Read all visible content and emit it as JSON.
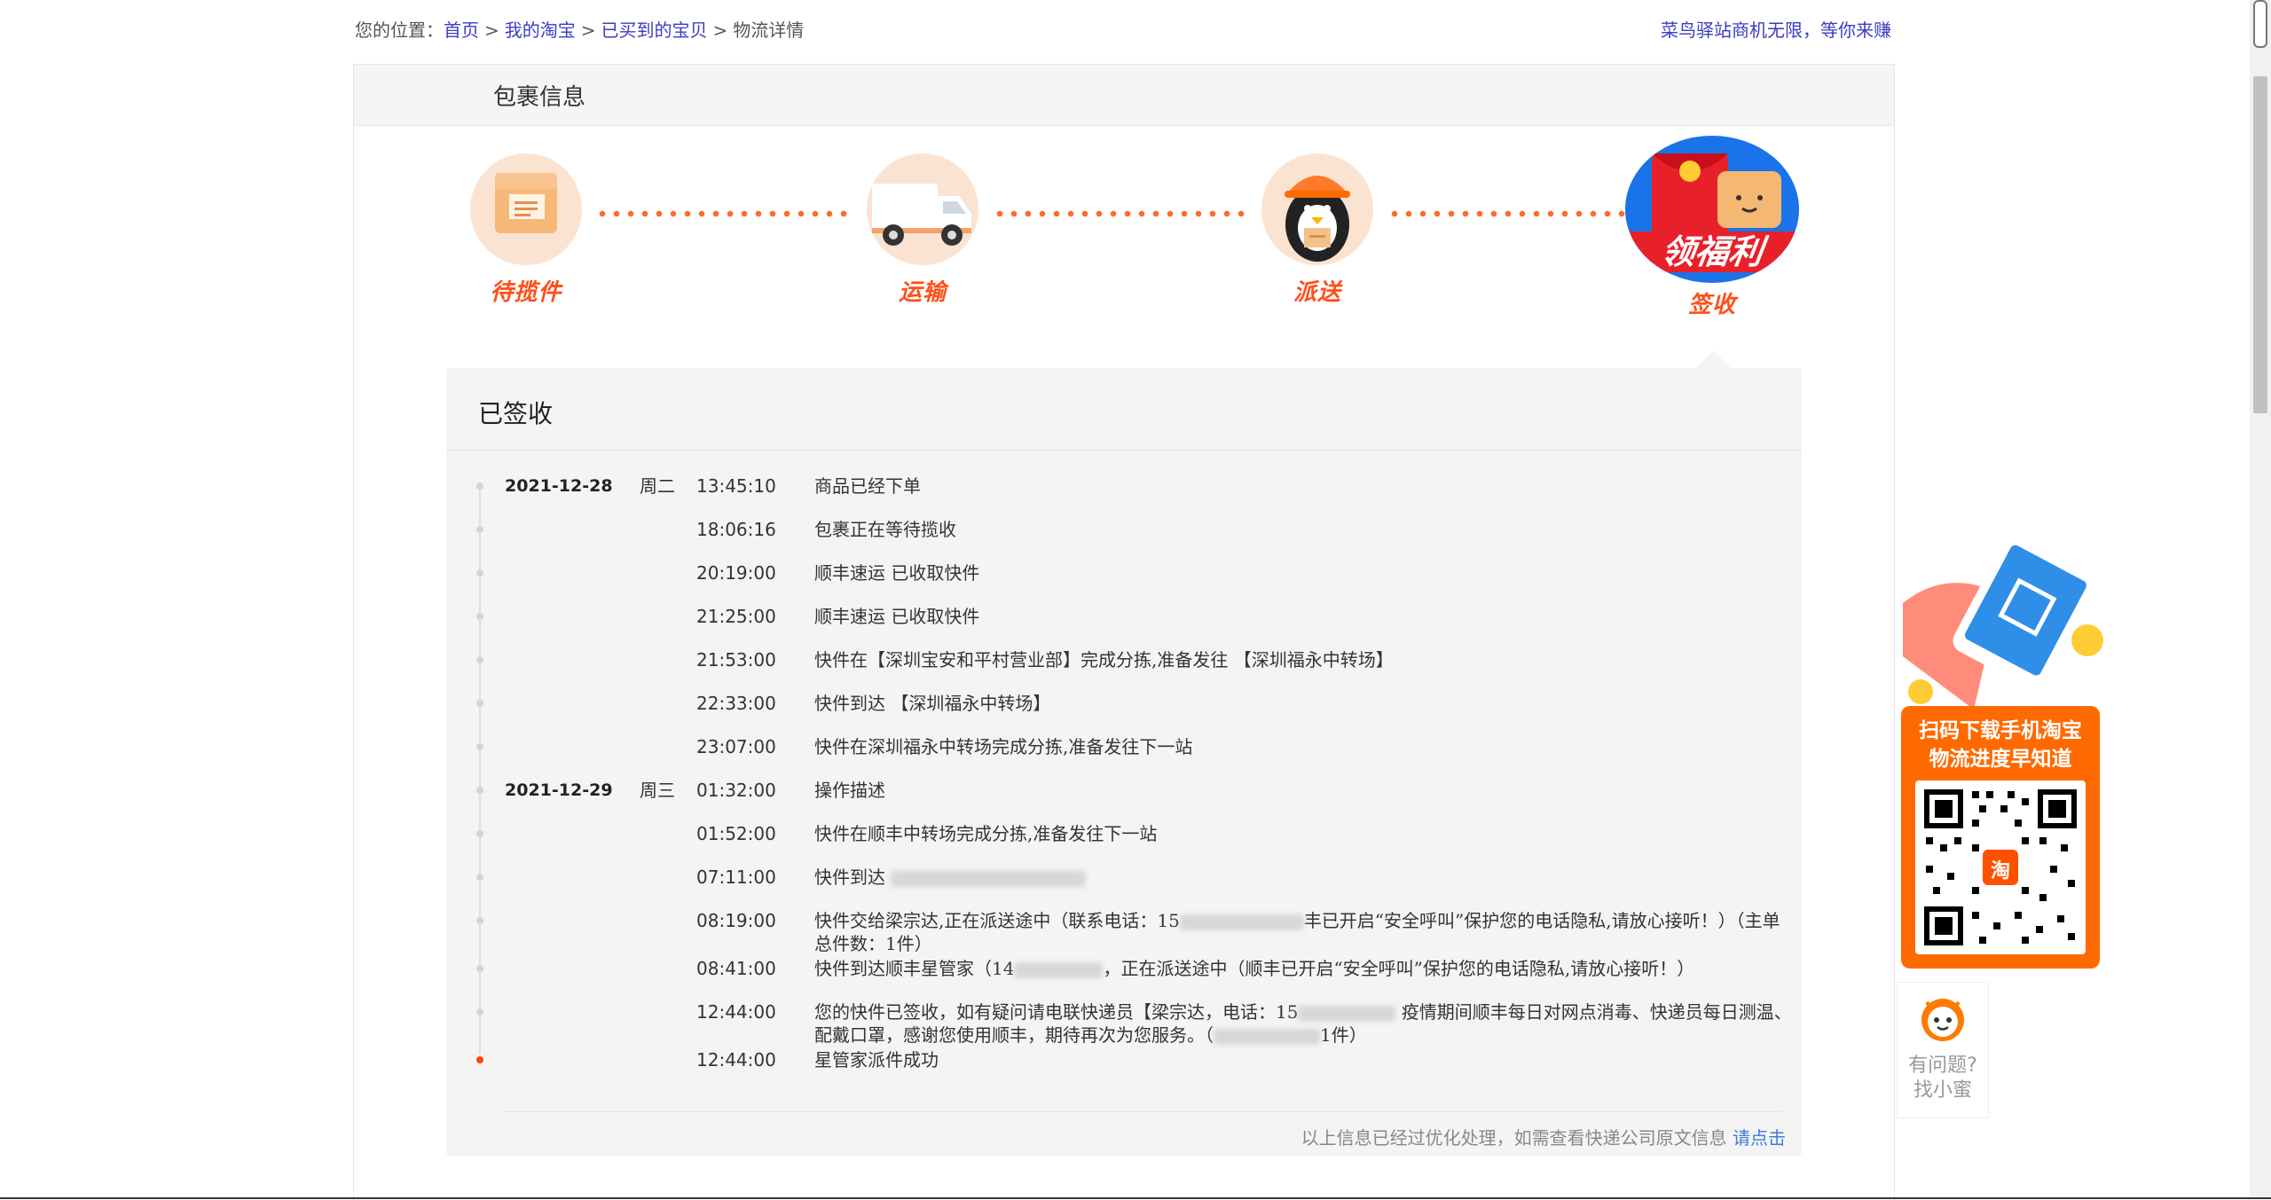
{
  "breadcrumb": {
    "prefix": "您的位置：",
    "items": [
      "首页",
      "我的淘宝",
      "已买到的宝贝"
    ],
    "current": "物流详情",
    "separator": ">"
  },
  "top_promo": "菜鸟驿站商机无限，等你来赚",
  "panel_title": "包裹信息",
  "steps": {
    "items": [
      {
        "label": "待揽件",
        "icon": "package-icon"
      },
      {
        "label": "运输",
        "icon": "truck-icon"
      },
      {
        "label": "派送",
        "icon": "courier-icon"
      },
      {
        "label": "签收",
        "icon": "red-envelope-icon"
      }
    ],
    "promo_banner": "领福利"
  },
  "status": {
    "title": "已签收",
    "events": [
      {
        "date": "2021-12-28",
        "weekday": "周二",
        "time": "13:45:10",
        "desc": "商品已经下单"
      },
      {
        "date": "",
        "weekday": "",
        "time": "18:06:16",
        "desc": "包裹正在等待揽收"
      },
      {
        "date": "",
        "weekday": "",
        "time": "20:19:00",
        "desc": "顺丰速运 已收取快件"
      },
      {
        "date": "",
        "weekday": "",
        "time": "21:25:00",
        "desc": "顺丰速运 已收取快件"
      },
      {
        "date": "",
        "weekday": "",
        "time": "21:53:00",
        "desc": "快件在【深圳宝安和平村营业部】完成分拣,准备发往 【深圳福永中转场】"
      },
      {
        "date": "",
        "weekday": "",
        "time": "22:33:00",
        "desc": "快件到达 【深圳福永中转场】"
      },
      {
        "date": "",
        "weekday": "",
        "time": "23:07:00",
        "desc": "快件在深圳福永中转场完成分拣,准备发往下一站"
      },
      {
        "date": "2021-12-29",
        "weekday": "周三",
        "time": "01:32:00",
        "desc": "操作描述"
      },
      {
        "date": "",
        "weekday": "",
        "time": "01:52:00",
        "desc": "快件在顺丰中转场完成分拣,准备发往下一站"
      },
      {
        "date": "",
        "weekday": "",
        "time": "07:11:00",
        "desc": "快件到达"
      },
      {
        "date": "",
        "weekday": "",
        "time": "08:19:00",
        "desc_a": "快件交给梁宗达,正在派送途中（联系电话：15",
        "desc_b": "丰已开启“安全呼叫”保护您的电话隐私,请放心接听！）（主单总件数：1件）"
      },
      {
        "date": "",
        "weekday": "",
        "time": "08:41:00",
        "desc_a": "快件到达顺丰星管家（14",
        "desc_b": "，正在派送途中（顺丰已开启“安全呼叫”保护您的电话隐私,请放心接听！）"
      },
      {
        "date": "",
        "weekday": "",
        "time": "12:44:00",
        "desc_a": "您的快件已签收，如有疑问请电联快递员【梁宗达，电话：15",
        "desc_b": "疫情期间顺丰每日对网点消毒、快递员每日测温、配戴口罩，感谢您使用顺丰，期待再次为您服务。（",
        "desc_c": "1件）"
      },
      {
        "date": "",
        "weekday": "",
        "time": "12:44:00",
        "desc": "星管家派件成功"
      }
    ],
    "footer_text": "以上信息已经过优化处理，如需查看快递公司原文信息",
    "footer_link": "请点击"
  },
  "side_ad": {
    "line1": "扫码下载手机淘宝",
    "line2": "物流进度早知道",
    "qr_center": "淘"
  },
  "helper": {
    "line1": "有问题?",
    "line2": "找小蜜"
  },
  "colors": {
    "accent": "#ff6a00",
    "link": "#3c3cc0",
    "label_red": "#ff4f1a"
  }
}
